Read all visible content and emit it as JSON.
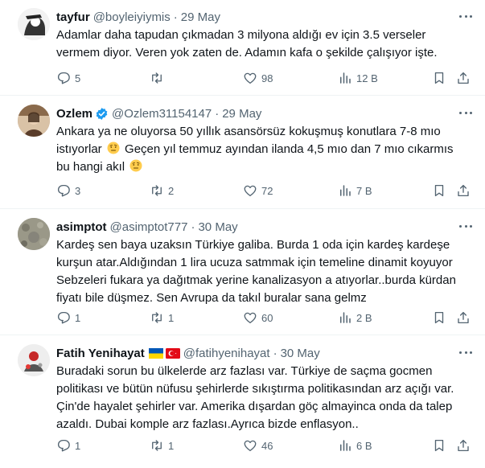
{
  "tweets": [
    {
      "name": "tayfur",
      "handle": "@boyleiyiymis",
      "date": "29 May",
      "lines": [
        "Adamlar daha tapudan çıkmadan 3 milyona aldığı ev için 3.5 verseler",
        "vermem diyor. Veren yok zaten de. Adamın kafa o şekilde çalışıyor işte."
      ],
      "replies": "5",
      "reposts": "",
      "likes": "98",
      "views": "12 B"
    },
    {
      "name": "Ozlem",
      "handle": "@Ozlem31154147",
      "date": "29 May",
      "lines": [
        "Ankara ya ne oluyorsa 50 yıllık asansörsüz kokuşmuş konutlara 7-8 mıo",
        "istıyorlar",
        "Geçen yıl temmuz ayından ilanda 4,5 mıo dan 7 mıo cıkarmıs",
        "bu hangi akıl"
      ],
      "replies": "3",
      "reposts": "2",
      "likes": "72",
      "views": "7 B"
    },
    {
      "name": "asimptot",
      "handle": "@asimptot777",
      "date": "30 May",
      "lines": [
        "Kardeş sen baya uzaksın Türkiye galiba. Burda 1 oda için kardeş kardeşe",
        "kurşun atar.Aldığından 1 lira ucuza satmmak için temeline dinamit koyuyor",
        "Sebzeleri fukara ya dağıtmak yerine kanalizasyon a atıyorlar..burda kürdan",
        "fiyatı bile düşmez. Sen Avrupa da takıl buralar sana gelmz"
      ],
      "replies": "1",
      "reposts": "1",
      "likes": "60",
      "views": "2 B"
    },
    {
      "name": "Fatih Yenihayat",
      "handle": "@fatihyenihayat",
      "date": "30 May",
      "lines": [
        "Buradaki sorun bu ülkelerde arz fazlası var. Türkiye de saçma  gocmen",
        "politikası ve bütün nüfusu şehirlerde sıkıştırma politikasından arz açığı var.",
        "Çin'de hayalet şehirler var. Amerika dışardan göç almayinca onda da talep",
        "azaldı. Dubai komple arz fazlası.Ayrıca bizde enflasyon.."
      ],
      "replies": "1",
      "reposts": "1",
      "likes": "46",
      "views": "6 B"
    }
  ],
  "colors": {
    "text": "#0f1419",
    "muted": "#536471",
    "verified": "#1d9bf0",
    "divider": "#eff3f4"
  },
  "icons": [
    "reply-icon",
    "repost-icon",
    "like-icon",
    "views-icon",
    "bookmark-icon",
    "share-icon",
    "more-icon",
    "verified-badge-icon",
    "face-with-raised-eyebrow-emoji",
    "ukraine-flag",
    "turkey-flag"
  ]
}
